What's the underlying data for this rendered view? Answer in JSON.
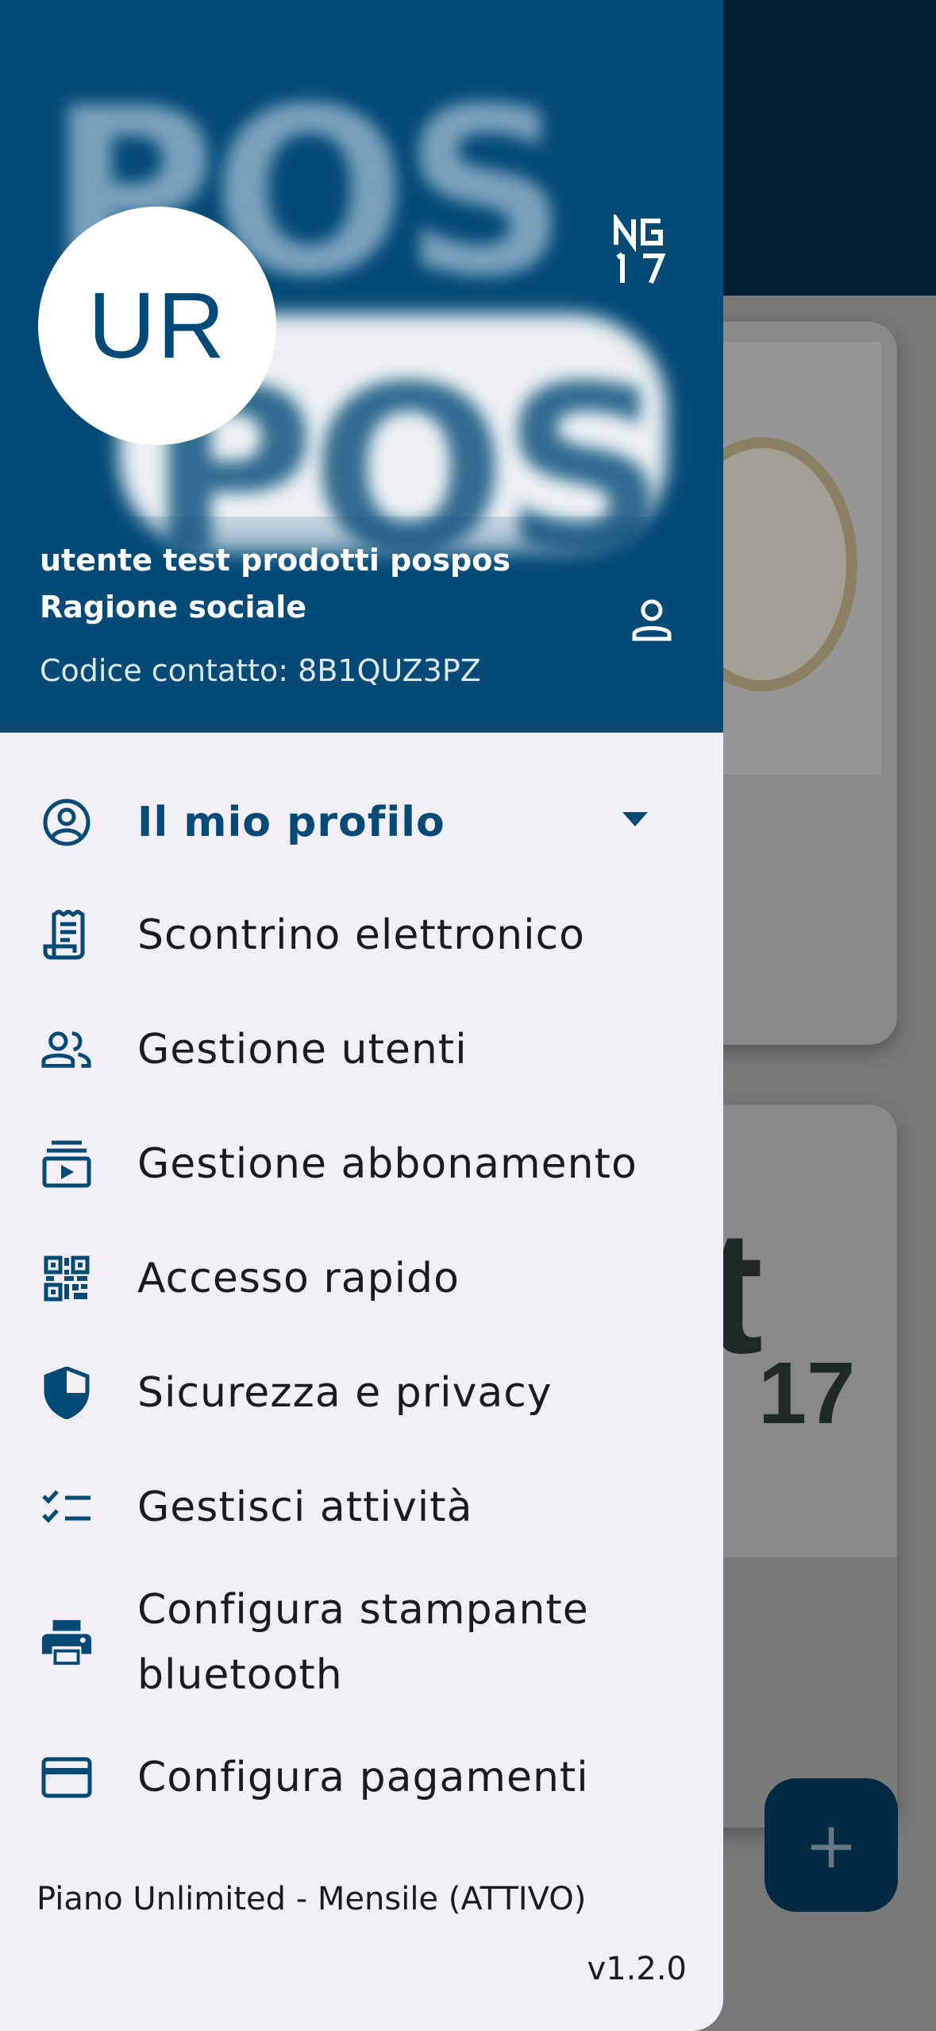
{
  "header": {
    "logo_text": "POS",
    "avatar_initials": "UR",
    "badge_text": "NG 17",
    "user_name": "utente test prodotti pospos",
    "company_name": "Ragione sociale",
    "contact_code": "Codice contatto: 8B1QUZ3PZ",
    "brand_color": "#034a76"
  },
  "menu": {
    "items": [
      {
        "label": "Il mio profilo",
        "icon": "account-circle-icon",
        "active": true,
        "expandable": true
      },
      {
        "label": "Scontrino elettronico",
        "icon": "receipt-icon"
      },
      {
        "label": "Gestione utenti",
        "icon": "people-icon"
      },
      {
        "label": "Gestione abbonamento",
        "icon": "subscriptions-icon"
      },
      {
        "label": "Accesso rapido",
        "icon": "qr-code-icon"
      },
      {
        "label": "Sicurezza e privacy",
        "icon": "shield-icon"
      },
      {
        "label": "Gestisci attività",
        "icon": "checklist-icon"
      },
      {
        "label": "Configura stampante bluetooth",
        "icon": "printer-icon"
      },
      {
        "label": "Configura pagamenti",
        "icon": "credit-card-icon"
      }
    ]
  },
  "footer": {
    "plan": "Piano Unlimited - Mensile (ATTIVO)",
    "version": "v1.2.0"
  },
  "background": {
    "card_text_large": "t",
    "card_text_number": "17",
    "fab_symbol": "+"
  }
}
